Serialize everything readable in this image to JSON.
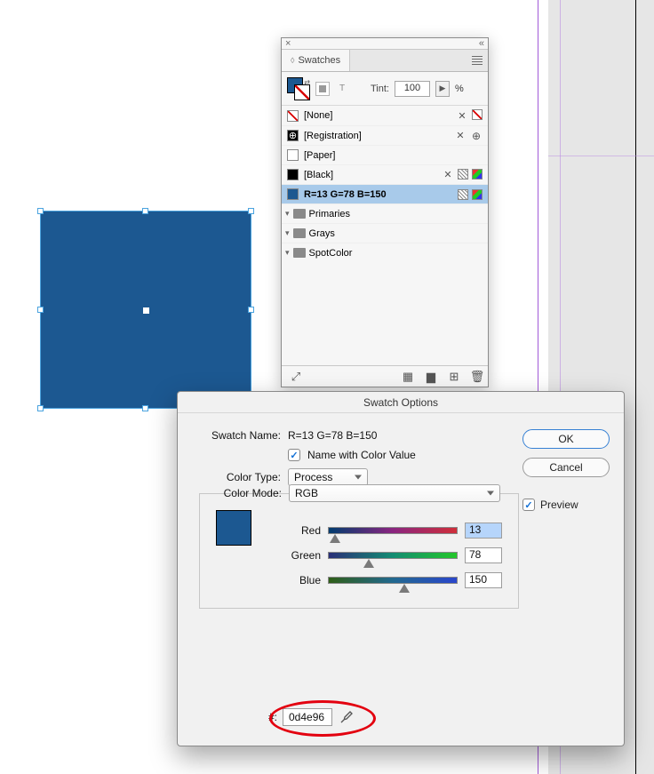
{
  "panel": {
    "title": "Swatches",
    "tint_label": "Tint:",
    "tint_value": "100",
    "tint_unit": "%",
    "close_x": "×",
    "collapse": "«",
    "swatches": [
      {
        "label": "[None]",
        "kind": "none",
        "icons": [
          "tools",
          "noned"
        ]
      },
      {
        "label": "[Registration]",
        "kind": "reg",
        "icons": [
          "tools",
          "target"
        ]
      },
      {
        "label": "[Paper]",
        "kind": "paper",
        "icons": []
      },
      {
        "label": "[Black]",
        "kind": "black",
        "icons": [
          "tools",
          "proc",
          "rgb"
        ]
      },
      {
        "label": "R=13 G=78 B=150",
        "kind": "blue",
        "icons": [
          "proc",
          "rgb"
        ],
        "selected": true,
        "bold": true
      }
    ],
    "groups": [
      {
        "label": "Primaries"
      },
      {
        "label": "Grays"
      },
      {
        "label": "SpotColor"
      }
    ]
  },
  "dialog": {
    "title": "Swatch Options",
    "labels": {
      "swatch_name": "Swatch Name:",
      "name_with_value": "Name with Color Value",
      "color_type": "Color Type:",
      "color_mode": "Color Mode:",
      "red": "Red",
      "green": "Green",
      "blue": "Blue",
      "hash": "#:",
      "ok": "OK",
      "cancel": "Cancel",
      "preview": "Preview"
    },
    "values": {
      "swatch_name": "R=13 G=78 B=150",
      "color_type": "Process",
      "color_mode": "RGB",
      "red": "13",
      "green": "78",
      "blue": "150",
      "hex": "0d4e96"
    },
    "slider_pos": {
      "red": 5,
      "green": 31,
      "blue": 59
    }
  }
}
